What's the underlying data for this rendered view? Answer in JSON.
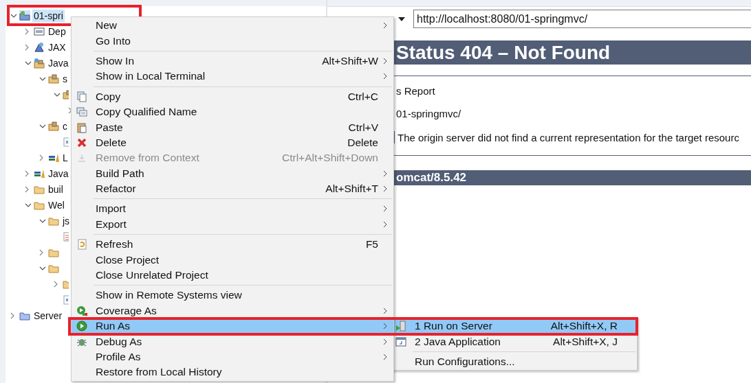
{
  "project_explorer": {
    "tree": [
      {
        "label": "01-spri",
        "kind": "project",
        "expanded": true,
        "selected": true,
        "marked": true,
        "children": [
          {
            "label": "Dep",
            "kind": "library",
            "expanded": false,
            "selected": false
          },
          {
            "label": "JAX",
            "kind": "jax",
            "expanded": false,
            "selected": false
          },
          {
            "label": "Java",
            "kind": "javasrc",
            "expanded": true,
            "selected": false,
            "children": [
              {
                "label": "s",
                "kind": "package",
                "expanded": true,
                "selected": false,
                "children": [
                  {
                    "kind": "pkg",
                    "expanded": true,
                    "selected": false,
                    "children": [
                      {
                        "expanded": false,
                        "selected": false
                      }
                    ]
                  }
                ]
              },
              {
                "label": "c",
                "kind": "package",
                "expanded": true,
                "selected": false,
                "children": [
                  {
                    "kind": "xml",
                    "selected": false
                  }
                ]
              },
              {
                "label": "L",
                "kind": "books",
                "expanded": false,
                "selected": false
              }
            ]
          },
          {
            "label": "Java",
            "kind": "books",
            "expanded": false,
            "selected": false
          },
          {
            "label": "buil",
            "kind": "folder",
            "expanded": false,
            "selected": false
          },
          {
            "label": "Wel",
            "kind": "folder",
            "expanded": true,
            "selected": false,
            "children": [
              {
                "label": "js",
                "kind": "folder",
                "expanded": true,
                "selected": false,
                "children": [
                  {
                    "kind": "file",
                    "selected": false
                  }
                ]
              },
              {
                "kind": "folder",
                "expanded": false,
                "selected": false
              },
              {
                "kind": "folder",
                "expanded": true,
                "selected": false,
                "children": [
                  {
                    "kind": "folder",
                    "expanded": false,
                    "selected": false
                  },
                  {
                    "kind": "xml",
                    "selected": false
                  }
                ]
              }
            ]
          }
        ]
      },
      {
        "label": "Server",
        "kind": "servers",
        "expanded": false,
        "selected": false
      }
    ]
  },
  "browser": {
    "url": "http://localhost:8080/01-springmvc/",
    "heading": "Status 404 – Not Found",
    "lines": [
      "s Report",
      "01-springmvc/",
      "The origin server did not find a current representation for the target resourc"
    ],
    "footer": "omcat/8.5.42"
  },
  "context_menu": {
    "sections": [
      [
        {
          "label": "New",
          "submenu": true,
          "selected": false
        },
        {
          "label": "Go Into",
          "selected": false
        }
      ],
      [
        {
          "label": "Show In",
          "shortcut": "Alt+Shift+W",
          "submenu": true,
          "selected": false
        },
        {
          "label": "Show in Local Terminal",
          "submenu": true,
          "selected": false
        }
      ],
      [
        {
          "label": "Copy",
          "shortcut": "Ctrl+C",
          "kind": "copy",
          "selected": false
        },
        {
          "label": "Copy Qualified Name",
          "kind": "copyname",
          "selected": false
        },
        {
          "label": "Paste",
          "shortcut": "Ctrl+V",
          "kind": "paste",
          "selected": false
        },
        {
          "label": "Delete",
          "shortcut": "Delete",
          "kind": "delete",
          "selected": false
        },
        {
          "label": "Remove from Context",
          "shortcut": "Ctrl+Alt+Shift+Down",
          "kind": "remove",
          "disabled": true,
          "selected": false
        },
        {
          "label": "Build Path",
          "submenu": true,
          "selected": false
        },
        {
          "label": "Refactor",
          "shortcut": "Alt+Shift+T",
          "submenu": true,
          "selected": false
        }
      ],
      [
        {
          "label": "Import",
          "submenu": true,
          "selected": false
        },
        {
          "label": "Export",
          "submenu": true,
          "selected": false
        }
      ],
      [
        {
          "label": "Refresh",
          "shortcut": "F5",
          "kind": "refresh",
          "selected": false
        },
        {
          "label": "Close Project",
          "selected": false
        },
        {
          "label": "Close Unrelated Project",
          "selected": false
        }
      ],
      [
        {
          "label": "Show in Remote Systems view",
          "selected": false
        },
        {
          "label": "Coverage As",
          "submenu": true,
          "kind": "coverage",
          "selected": false
        },
        {
          "label": "Run As",
          "submenu": true,
          "kind": "run",
          "selected": true,
          "marked": true
        },
        {
          "label": "Debug As",
          "submenu": true,
          "kind": "bug",
          "selected": false
        },
        {
          "label": "Profile As",
          "submenu": true,
          "selected": false
        },
        {
          "label": "Restore from Local History",
          "selected": false
        }
      ]
    ]
  },
  "run_as_submenu": {
    "sections": [
      [
        {
          "label": "1 Run on Server",
          "shortcut": "Alt+Shift+X, R",
          "kind": "server",
          "selected": true
        },
        {
          "label": "2 Java Application",
          "shortcut": "Alt+Shift+X, J",
          "kind": "javaapp",
          "selected": false
        }
      ],
      [
        {
          "label": "Run Configurations...",
          "selected": false
        }
      ]
    ]
  }
}
